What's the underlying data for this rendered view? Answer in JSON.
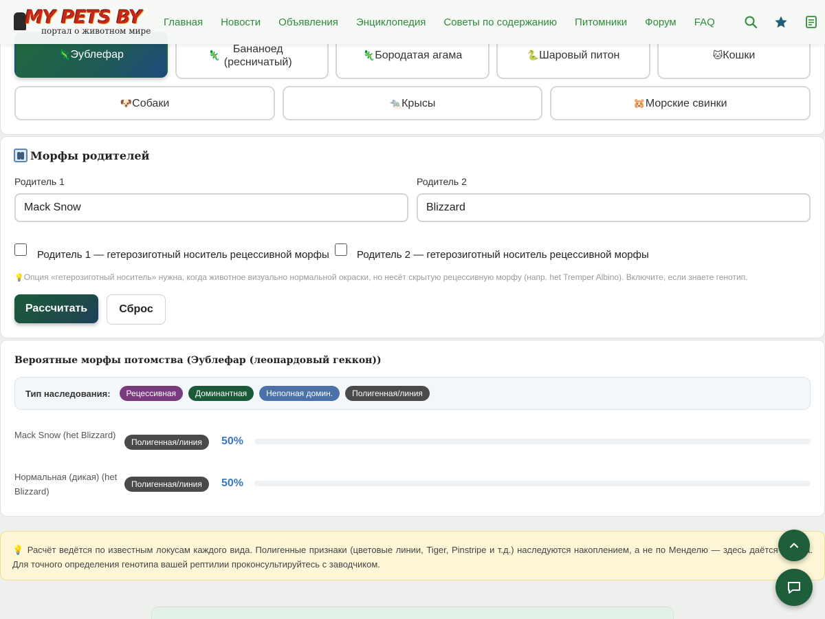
{
  "header": {
    "logo_text": "MY PETS BY",
    "logo_subtitle": "портал о животном мире",
    "nav": [
      "Главная",
      "Новости",
      "Объявления",
      "Энциклопедия",
      "Советы по содержанию",
      "Питомники",
      "Форум",
      "FAQ"
    ],
    "icons": [
      "search-icon",
      "star-icon",
      "notes-icon"
    ]
  },
  "species": {
    "row1": [
      {
        "label": "Эублефар",
        "emoji": "🦎",
        "active": true
      },
      {
        "label": "Бананоед (ресничатый)",
        "emoji": "🦎",
        "active": false
      },
      {
        "label": "Бородатая агама",
        "emoji": "🦎",
        "active": false
      },
      {
        "label": "Шаровый питон",
        "emoji": "🐍",
        "active": false
      },
      {
        "label": "Кошки",
        "emoji": "🐱",
        "active": false
      }
    ],
    "row2": [
      {
        "label": "Собаки",
        "emoji": "🐶"
      },
      {
        "label": "Крысы",
        "emoji": "🐀"
      },
      {
        "label": "Морские свинки",
        "emoji": "🐹"
      }
    ]
  },
  "parents": {
    "title": "Морфы родителей",
    "parent1_label": "Родитель 1",
    "parent1_value": "Mack Snow",
    "parent2_label": "Родитель 2",
    "parent2_value": "Blizzard",
    "het1_label": "Родитель 1 — гетерозиготный носитель рецессивной морфы",
    "het2_label": "Родитель 2 — гетерозиготный носитель рецессивной морфы",
    "hint": "Опция «гетерозиготный носитель» нужна, когда животное визуально нормальной окраски, но несёт скрытую рецессивную морфу (напр. het Tremper Albino). Включите, если знаете генотип.",
    "calc_button": "Рассчитать",
    "reset_button": "Сброс"
  },
  "results": {
    "title": "Вероятные морфы потомства (Эублефар (леопардовый геккон))",
    "inheritance_label": "Тип наследования:",
    "legend": [
      {
        "label": "Рецессивная",
        "color": "#7a3b7e"
      },
      {
        "label": "Доминантная",
        "color": "#1b5a38"
      },
      {
        "label": "Неполная домин.",
        "color": "#4a72a8"
      },
      {
        "label": "Полигенная/линия",
        "color": "#4a4a4a"
      }
    ],
    "rows": [
      {
        "name": "Mack Snow (het Blizzard)",
        "type": "Полигенная/линия",
        "percent": "50%",
        "fraction": 0.5
      },
      {
        "name": "Нормальная (дикая) (het Blizzard)",
        "type": "Полигенная/линия",
        "percent": "50%",
        "fraction": 0.5
      }
    ]
  },
  "note": "Расчёт ведётся по известным локусам каждого вида. Полигенные признаки (цветовые линии, Tiger, Pinstripe и т.д.) наследуются накоплением, а не по Менделю — здесь даётся оценка. Для точного определения генотипа вашей рептилии проконсультируйтесь с заводчиком.",
  "fabs": [
    "scroll-top-icon",
    "chat-icon"
  ]
}
